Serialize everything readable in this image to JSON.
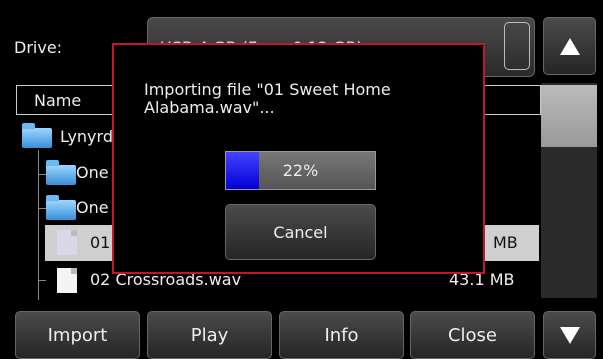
{
  "drive": {
    "label": "Drive:",
    "value": "USB 4 GB (Free: 0.12 GB)"
  },
  "list": {
    "header_name": "Name",
    "rows": [
      {
        "name": "Lynyrd",
        "type": "folder"
      },
      {
        "name": "One",
        "type": "folder"
      },
      {
        "name": "One",
        "type": "folder"
      },
      {
        "name": "01",
        "size": "MB",
        "type": "file",
        "selected": true
      },
      {
        "name": "02 Crossroads.wav",
        "size": "43.1 MB",
        "type": "file"
      }
    ]
  },
  "buttons": {
    "import": "Import",
    "play": "Play",
    "info": "Info",
    "close": "Close"
  },
  "dialog": {
    "message": "Importing file \"01 Sweet Home Alabama.wav\"...",
    "progress_percent": 22,
    "progress_label": "22%",
    "cancel": "Cancel"
  },
  "icons": {
    "scroll_up": "triangle-up-icon",
    "scroll_down": "triangle-down-icon",
    "folder": "folder-icon",
    "file": "file-icon"
  },
  "colors": {
    "dialog_border": "#c0182a",
    "progress_fill": "#0000d6",
    "selected_row": "#cfcfcf"
  }
}
